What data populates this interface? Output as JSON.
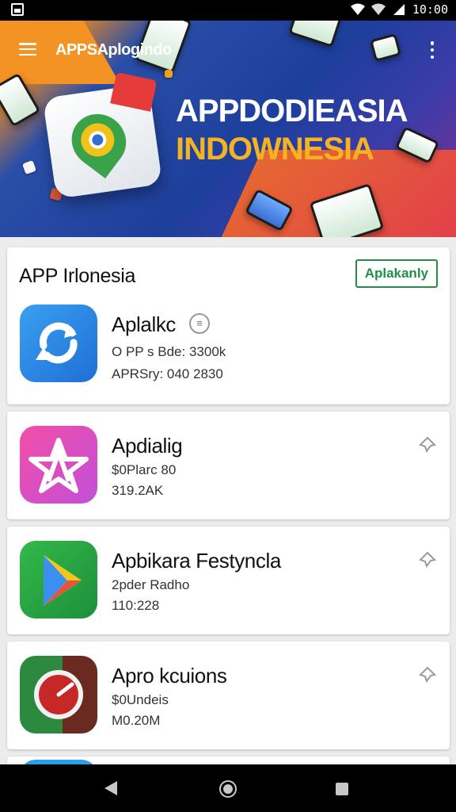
{
  "status_bar": {
    "time": "10:00"
  },
  "app_bar": {
    "title": "APPSAplogindo"
  },
  "banner": {
    "line1": "APPDODIEASIA",
    "line2": "INDOWNESIA"
  },
  "section": {
    "title": "APP Irlonesia",
    "button_label": "Aplakanly"
  },
  "apps": [
    {
      "name": "Aplalkc",
      "meta1": "O PP s Bde: 3300k",
      "meta2": "APRSry: 040  2830",
      "colors": [
        "#3aa0f0",
        "#1f6fd6"
      ]
    },
    {
      "name": "Apdialig",
      "meta1": "$0Plarc 80",
      "meta2": "319.2AK",
      "colors": [
        "#f24fa8",
        "#c24fd8"
      ]
    },
    {
      "name": "Apbikara Festyncla",
      "meta1": "2pder Radho",
      "meta2": "110:228",
      "colors": [
        "#33b84a",
        "#1e8f3a"
      ]
    },
    {
      "name": "Apro kcuions",
      "meta1": "$0Undeis",
      "meta2": "M0.20M",
      "colors": [
        "#2b8a3e",
        "#6b2a1f"
      ]
    }
  ],
  "icons": {
    "status_left": "gallery-icon",
    "wifi": "wifi-icon",
    "signal": "signal-icon",
    "menu": "hamburger-icon",
    "more": "overflow-menu-icon",
    "pin": "pin-icon",
    "badge": "verified-badge-icon"
  }
}
